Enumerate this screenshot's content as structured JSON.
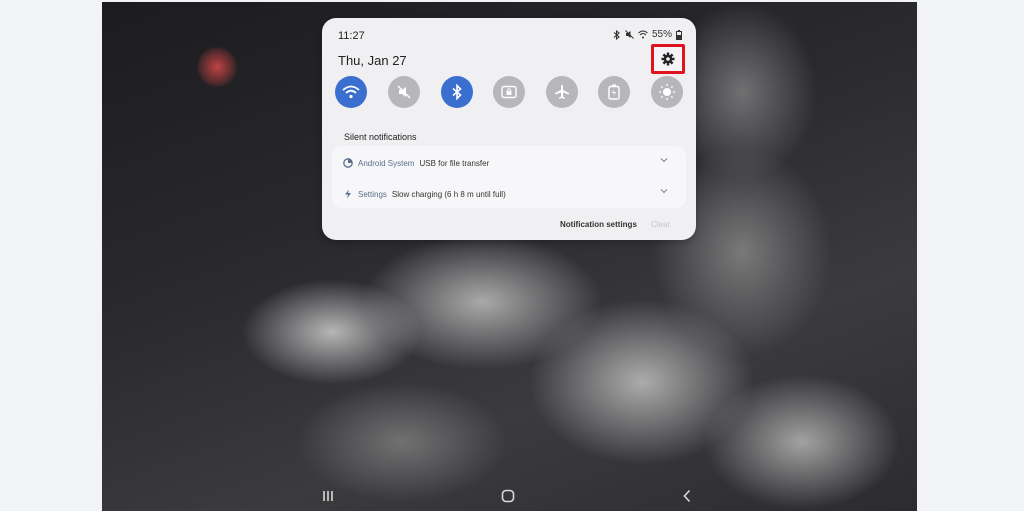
{
  "status_bar": {
    "time": "11:27",
    "battery": "55%",
    "icons": [
      "bluetooth-icon",
      "mute-icon",
      "wifi-signal-icon",
      "battery-icon"
    ]
  },
  "panel": {
    "date": "Thu, Jan 27",
    "settings_icon": "gear-icon",
    "highlight_color": "#e0141e",
    "quick_toggles": [
      {
        "name": "wifi",
        "icon": "wifi-icon",
        "state": "on"
      },
      {
        "name": "sound",
        "icon": "mute-icon",
        "state": "off"
      },
      {
        "name": "bluetooth",
        "icon": "bluetooth-icon",
        "state": "on"
      },
      {
        "name": "screen-lock",
        "icon": "lock-rotation-icon",
        "state": "off"
      },
      {
        "name": "airplane-mode",
        "icon": "airplane-icon",
        "state": "off"
      },
      {
        "name": "power-saving",
        "icon": "battery-saver-icon",
        "state": "off"
      },
      {
        "name": "brightness",
        "icon": "brightness-icon",
        "state": "off"
      }
    ],
    "section_title": "Silent notifications",
    "notifications": [
      {
        "app": "Android System",
        "message": "USB for file transfer",
        "icon": "android-system-icon"
      },
      {
        "app": "Settings",
        "message": "Slow charging (6 h 8 m until full)",
        "icon": "charging-bolt-icon"
      }
    ],
    "notification_settings_label": "Notification settings",
    "clear_label": "Clear"
  },
  "colors": {
    "toggle_on": "#3a6fd0",
    "toggle_off": "#b7b7bb",
    "panel_bg": "#f0f0f2"
  },
  "nav_bar": {
    "buttons": [
      "recent-apps-icon",
      "home-icon",
      "back-icon"
    ]
  }
}
